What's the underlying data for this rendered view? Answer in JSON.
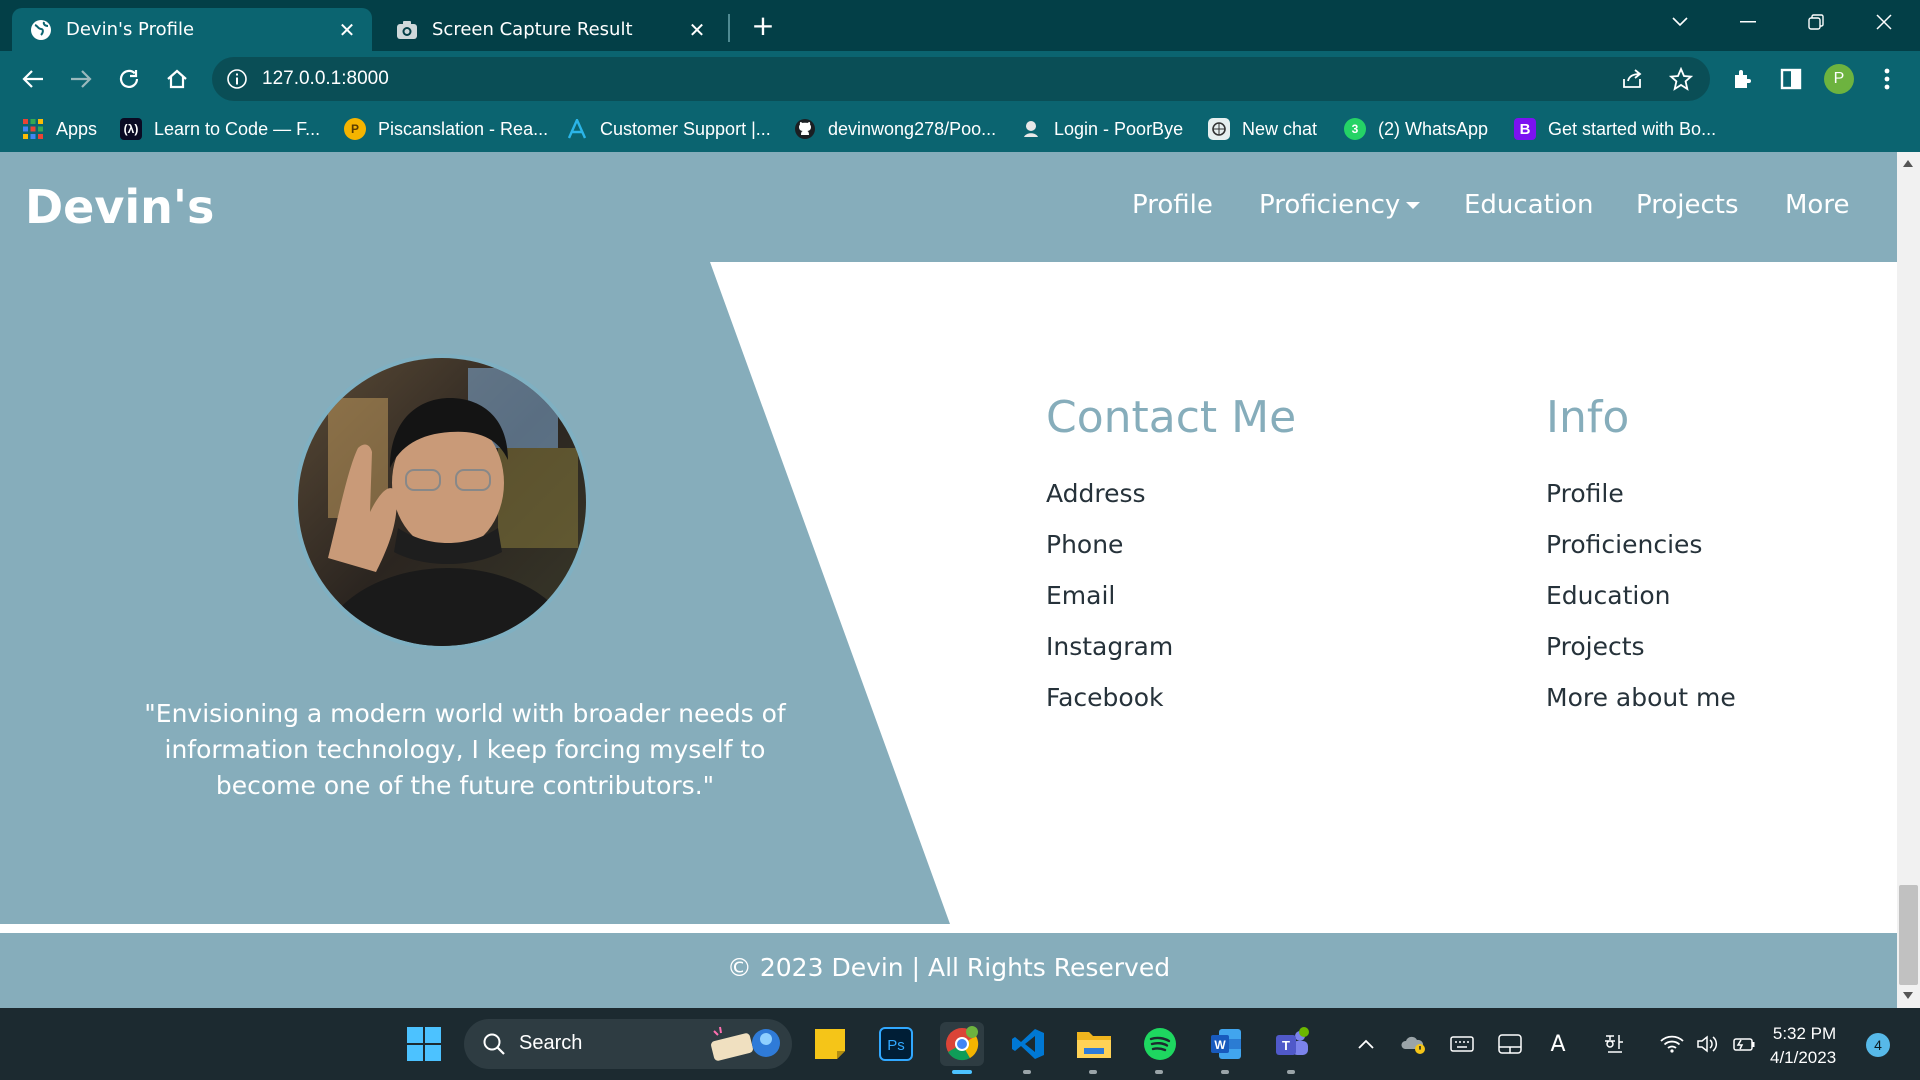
{
  "browser": {
    "tabs": [
      {
        "label": "Devin's Profile",
        "icon": "globe-icon",
        "active": true
      },
      {
        "label": "Screen Capture Result",
        "icon": "camera-icon",
        "active": false
      }
    ],
    "url": "127.0.0.1:8000",
    "profile_initial": "P",
    "bookmarks": [
      {
        "label": "Apps",
        "icon": "apps-grid-icon"
      },
      {
        "label": "Learn to Code — F...",
        "icon": "freecodecamp-icon"
      },
      {
        "label": "Piscanslation - Rea...",
        "icon": "piscanslation-icon"
      },
      {
        "label": "Customer Support |...",
        "icon": "support-icon"
      },
      {
        "label": "devinwong278/Poo...",
        "icon": "github-icon"
      },
      {
        "label": "Login - PoorBye",
        "icon": "poorbye-icon"
      },
      {
        "label": "New chat",
        "icon": "chatgpt-icon"
      },
      {
        "label": "(2) WhatsApp",
        "icon": "whatsapp-icon"
      },
      {
        "label": "Get started with Bo...",
        "icon": "bootstrap-icon"
      }
    ]
  },
  "site": {
    "brand": "Devin's",
    "nav": [
      {
        "label": "Profile"
      },
      {
        "label": "Proficiency"
      },
      {
        "label": "Education"
      },
      {
        "label": "Projects"
      },
      {
        "label": "More"
      }
    ],
    "quote": "\"Envisioning a modern world with broader needs of information technology, I keep forcing myself to become one of the future contributors.\"",
    "contact": {
      "title": "Contact Me",
      "links": [
        "Address",
        "Phone",
        "Email",
        "Instagram",
        "Facebook"
      ]
    },
    "info": {
      "title": "Info",
      "links": [
        "Profile",
        "Proficiencies",
        "Education",
        "Projects",
        "More about me"
      ]
    },
    "footer": "© 2023 Devin | All Rights Reserved"
  },
  "taskbar": {
    "search_label": "Search",
    "time": "5:32 PM",
    "date": "4/1/2023",
    "notifications": "4"
  },
  "colors": {
    "chrome_dark": "#033f47",
    "chrome": "#0b6470",
    "site_accent": "#86adbb",
    "taskbar": "#1c2a30"
  }
}
